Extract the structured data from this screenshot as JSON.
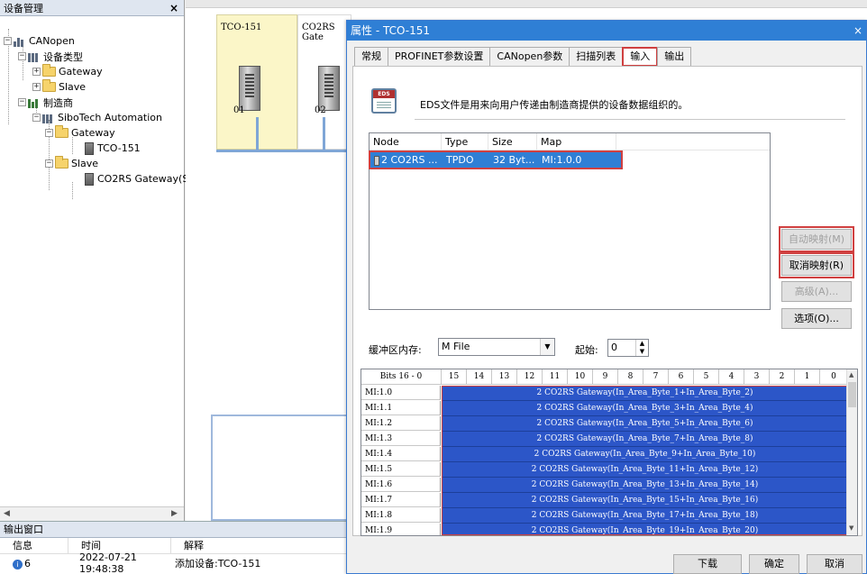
{
  "left_panel": {
    "title": "设备管理",
    "close": "×",
    "tree": {
      "root": "CANopen",
      "device_types": "设备类型",
      "type_gateway": "Gateway",
      "type_slave": "Slave",
      "manufacturers": "制造商",
      "vendor": "SiboTech Automation",
      "vendor_gateway": "Gateway",
      "gateway_device": "TCO-151",
      "vendor_slave": "Slave",
      "slave_device": "CO2RS Gateway(S"
    }
  },
  "canvas": {
    "slot1_label": "TCO-151",
    "slot2_label": "CO2RS Gate",
    "slot1_num": "01",
    "slot2_num": "02"
  },
  "output": {
    "title": "输出窗口",
    "col_info": "信息",
    "col_time": "时间",
    "col_desc": "解释",
    "row_info": "6",
    "row_time": "2022-07-21 19:48:38",
    "row_desc": "添加设备:TCO-151"
  },
  "dialog": {
    "title": "属性 - TCO-151",
    "close": "×",
    "tabs": [
      "常规",
      "PROFINET参数设置",
      "CANopen参数",
      "扫描列表",
      "输入",
      "输出"
    ],
    "active_tab": "输入",
    "eds_text": "EDS文件是用来向用户传递由制造商提供的设备数据组织的。",
    "map_headers": [
      "Node",
      "Type",
      "Size",
      "Map"
    ],
    "map_rows": [
      {
        "node": "2  CO2RS ...",
        "type": "TPDO",
        "size": "32 Byt...",
        "map": "MI:1.0.0"
      }
    ],
    "buttons": {
      "auto_map": "自动映射(M)",
      "cancel_map": "取消映射(R)",
      "advanced": "高级(A)...",
      "options": "选项(O)...",
      "download": "下载",
      "ok": "确定",
      "cancel": "取消"
    },
    "buffer_label": "缓冲区内存:",
    "buffer_value": "M File",
    "start_label": "起始:",
    "start_value": "0",
    "bits_header": [
      "Bits 16 - 0",
      "15",
      "14",
      "13",
      "12",
      "11",
      "10",
      "9",
      "8",
      "7",
      "6",
      "5",
      "4",
      "3",
      "2",
      "1",
      "0"
    ],
    "bit_rows": [
      {
        "label": "MI:1.0",
        "value": "2  CO2RS Gateway(In_Area_Byte_1+In_Area_Byte_2)"
      },
      {
        "label": "MI:1.1",
        "value": "2  CO2RS Gateway(In_Area_Byte_3+In_Area_Byte_4)"
      },
      {
        "label": "MI:1.2",
        "value": "2  CO2RS Gateway(In_Area_Byte_5+In_Area_Byte_6)"
      },
      {
        "label": "MI:1.3",
        "value": "2  CO2RS Gateway(In_Area_Byte_7+In_Area_Byte_8)"
      },
      {
        "label": "MI:1.4",
        "value": "2  CO2RS Gateway(In_Area_Byte_9+In_Area_Byte_10)"
      },
      {
        "label": "MI:1.5",
        "value": "2  CO2RS Gateway(In_Area_Byte_11+In_Area_Byte_12)"
      },
      {
        "label": "MI:1.6",
        "value": "2  CO2RS Gateway(In_Area_Byte_13+In_Area_Byte_14)"
      },
      {
        "label": "MI:1.7",
        "value": "2  CO2RS Gateway(In_Area_Byte_15+In_Area_Byte_16)"
      },
      {
        "label": "MI:1.8",
        "value": "2  CO2RS Gateway(In_Area_Byte_17+In_Area_Byte_18)"
      },
      {
        "label": "MI:1.9",
        "value": "2  CO2RS Gateway(In_Area_Byte_19+In_Area_Byte_20)"
      }
    ]
  },
  "colors": {
    "title_bar": "#2f7fd5",
    "selection": "#2c56c8",
    "highlight_box": "#d04040",
    "bus": "#7fa6d6"
  }
}
